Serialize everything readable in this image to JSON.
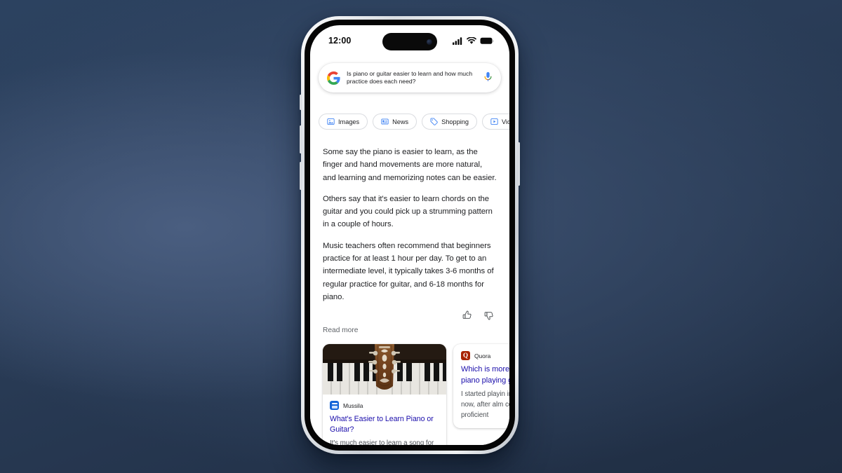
{
  "background": {
    "color_dark": "#1f2d42",
    "color_mid": "#2c4260",
    "color_light": "#4a5e80"
  },
  "device": {
    "name": "smartphone-mockup",
    "frame_color": "#d9dde2",
    "bezel_color": "#050505"
  },
  "status_bar": {
    "time": "12:00",
    "icons": [
      "cellular-signal-icon",
      "wifi-icon",
      "battery-icon"
    ]
  },
  "search": {
    "logo": "google-logo-icon",
    "query": "Is piano or guitar easier to learn and how much practice does each need?",
    "mic_icon": "microphone-icon"
  },
  "chips": [
    {
      "label": "Images",
      "icon": "image-icon"
    },
    {
      "label": "News",
      "icon": "news-icon"
    },
    {
      "label": "Shopping",
      "icon": "price-tag-icon"
    },
    {
      "label": "Videos",
      "icon": "video-play-icon"
    }
  ],
  "answer": {
    "paragraphs": [
      "Some say the piano is easier to learn, as the finger and hand movements are more natural, and learning and memorizing notes can be easier.",
      "Others say that it's easier to learn chords on the guitar and you could pick up a strumming pattern in a couple of hours.",
      "Music teachers often recommend that beginners practice for at least 1 hour per day. To get to an intermediate level, it typically takes 3-6 months of regular practice for guitar, and 6-18 months for piano."
    ],
    "feedback": {
      "thumbs_up": "thumbs-up-icon",
      "thumbs_down": "thumbs-down-icon"
    },
    "read_more_label": "Read more"
  },
  "cards": [
    {
      "id": "mussila",
      "thumbnail_alt": "guitar-headstock-over-piano-keys-photo",
      "source": "Mussila",
      "favicon": "mussila-favicon",
      "favicon_color": "#1565d8",
      "title": "What's Easier to Learn Piano or Guitar?",
      "snippet": "It's much easier to learn a song for the guitar than to learn it for",
      "title_color": "#1a0dab"
    },
    {
      "id": "quora",
      "source": "Quora",
      "favicon": "quora-favicon",
      "favicon_color": "#a82400",
      "favicon_letter": "Q",
      "title": "Which is more playing piano playing guitar",
      "snippet": "I started playin instruments th now, after alm continue to d proficient",
      "title_color": "#1a0dab"
    }
  ]
}
